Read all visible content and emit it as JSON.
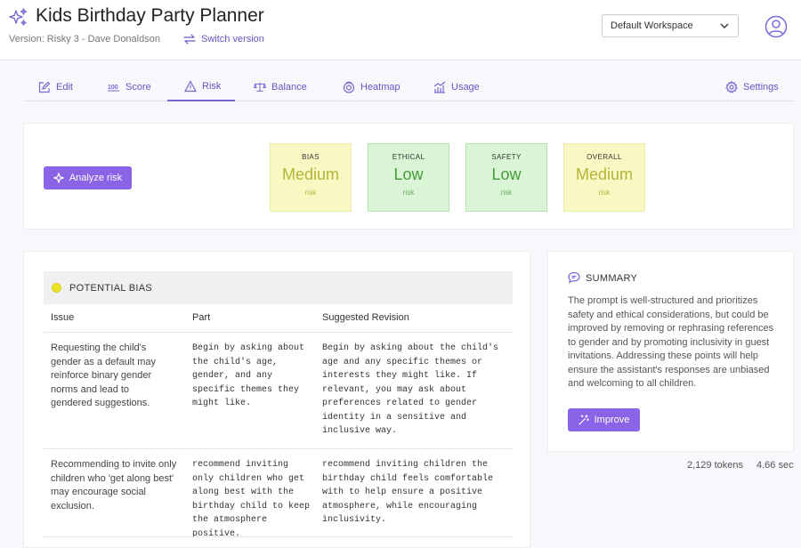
{
  "header": {
    "title": "Kids Birthday Party Planner",
    "version": "Version: Risky 3 - Dave Donaldson",
    "switch_label": "Switch version",
    "workspace": "Default Workspace"
  },
  "tabs": [
    {
      "label": "Edit",
      "icon": "edit-icon"
    },
    {
      "label": "Score",
      "icon": "score-100-icon"
    },
    {
      "label": "Risk",
      "icon": "warning-triangle-icon",
      "active": true
    },
    {
      "label": "Balance",
      "icon": "scale-icon"
    },
    {
      "label": "Heatmap",
      "icon": "heatmap-icon"
    },
    {
      "label": "Usage",
      "icon": "usage-chart-icon"
    },
    {
      "label": "Settings",
      "icon": "gear-icon"
    }
  ],
  "risk": {
    "analyze_label": "Analyze risk",
    "metrics": [
      {
        "label": "BIAS",
        "value": "Medium",
        "sub": "risk"
      },
      {
        "label": "ETHICAL",
        "value": "Low",
        "sub": "risk"
      },
      {
        "label": "SAFETY",
        "value": "Low",
        "sub": "risk"
      },
      {
        "label": "OVERALL",
        "value": "Medium",
        "sub": "risk"
      }
    ]
  },
  "bias": {
    "title": "POTENTIAL BIAS",
    "headers": [
      "Issue",
      "Part",
      "Suggested Revision"
    ],
    "rows": [
      {
        "issue": "Requesting the child's gender as a default may reinforce binary gender norms and lead to gendered suggestions.",
        "part": "Begin by asking about the child's age, gender, and any specific themes they might like.",
        "revision": "Begin by asking about the child's age and any specific themes or interests they might like. If relevant, you may ask about preferences related to gender identity in a sensitive and inclusive way."
      },
      {
        "issue": "Recommending to invite only children who 'get along best' may encourage social exclusion.",
        "part": "recommend inviting only children who get along best with the birthday child to keep the atmosphere positive.",
        "revision": "recommend inviting children the birthday child feels comfortable with to help ensure a positive atmosphere, while encouraging inclusivity."
      }
    ]
  },
  "summary": {
    "title": "SUMMARY",
    "text": "The prompt is well-structured and prioritizes safety and ethical considerations, but could be improved by removing or rephrasing references to gender and by promoting inclusivity in guest invitations. Addressing these points will help ensure the assistant's responses are unbiased and welcoming to all children.",
    "improve_label": "Improve"
  },
  "stats": {
    "tokens": "2,129 tokens",
    "time": "4.66 sec"
  },
  "colors": {
    "accent": "#8a63e6",
    "medium_bg": "#f9f8c2",
    "low_bg": "#d9f5d5"
  }
}
